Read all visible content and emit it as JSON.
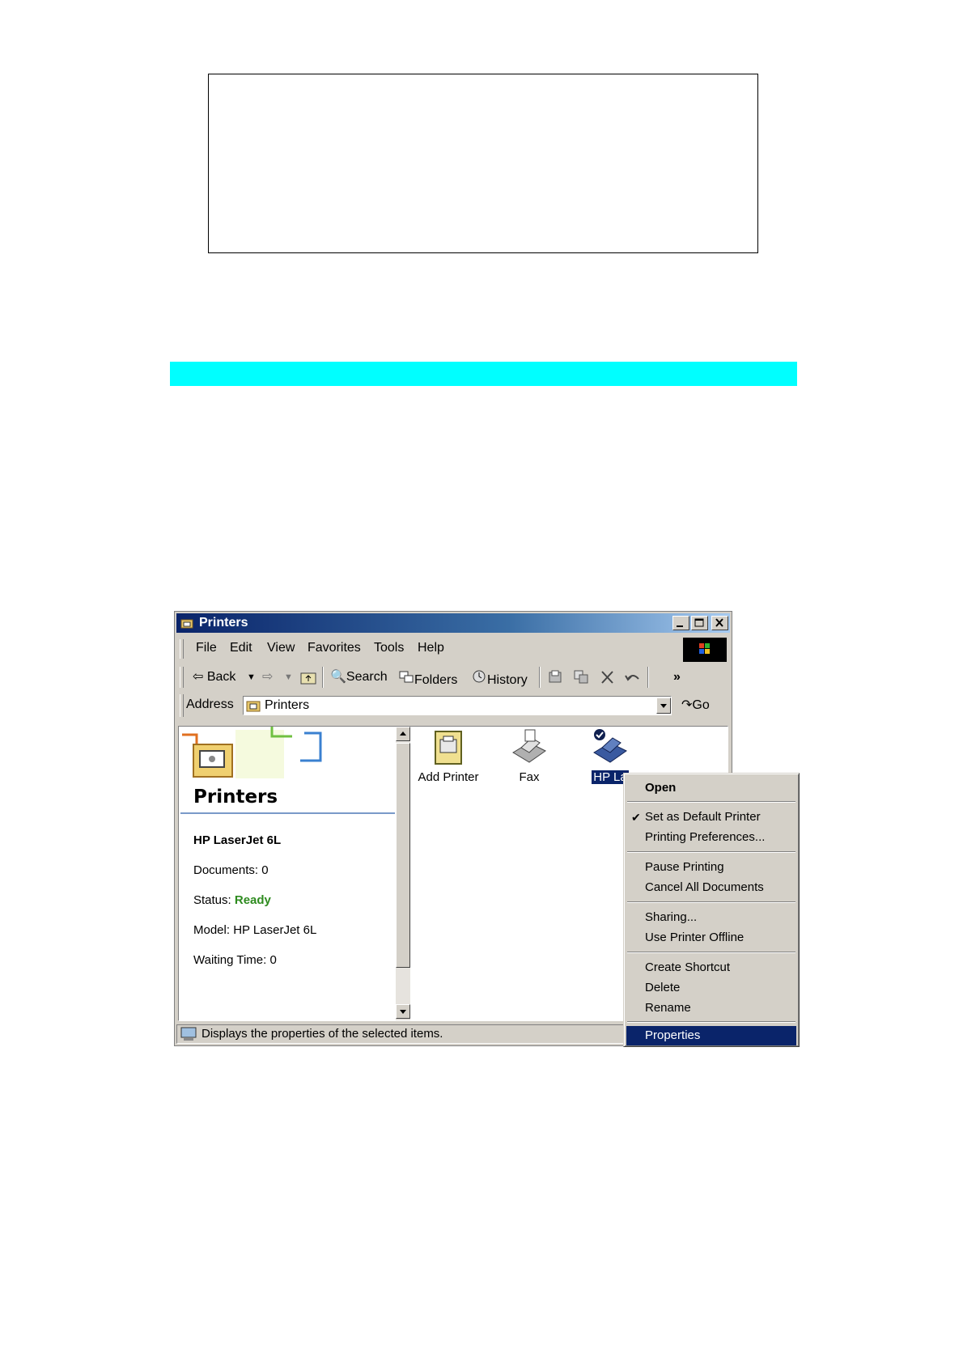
{
  "window": {
    "title": "Printers",
    "menu": [
      "File",
      "Edit",
      "View",
      "Favorites",
      "Tools",
      "Help"
    ],
    "toolbar": {
      "back": "Back",
      "search": "Search",
      "folders": "Folders",
      "history": "History",
      "more": "»"
    },
    "address": {
      "label": "Address",
      "value": "Printers",
      "go": "Go"
    },
    "left_pane": {
      "title": "Printers",
      "printer_name": "HP LaserJet 6L",
      "documents": "Documents: 0",
      "status_label": "Status:",
      "status_value": "Ready",
      "model": "Model: HP LaserJet 6L",
      "waiting": "Waiting Time: 0"
    },
    "icons": [
      {
        "label": "Add Printer",
        "icon": "add-printer-icon"
      },
      {
        "label": "Fax",
        "icon": "fax-icon"
      },
      {
        "label": "HP La",
        "icon": "default-printer-icon"
      }
    ],
    "status_text": "Displays the properties of the selected items."
  },
  "context_menu": {
    "open": "Open",
    "set_default": "Set as Default Printer",
    "printing_prefs": "Printing Preferences...",
    "pause": "Pause Printing",
    "cancel_all": "Cancel All Documents",
    "sharing": "Sharing...",
    "offline": "Use Printer Offline",
    "create_shortcut": "Create Shortcut",
    "delete": "Delete",
    "rename": "Rename",
    "properties": "Properties"
  },
  "colors": {
    "highlight": "#0a246a",
    "status_ready": "#2e8b1f",
    "accent_bar": "#00ffff"
  }
}
